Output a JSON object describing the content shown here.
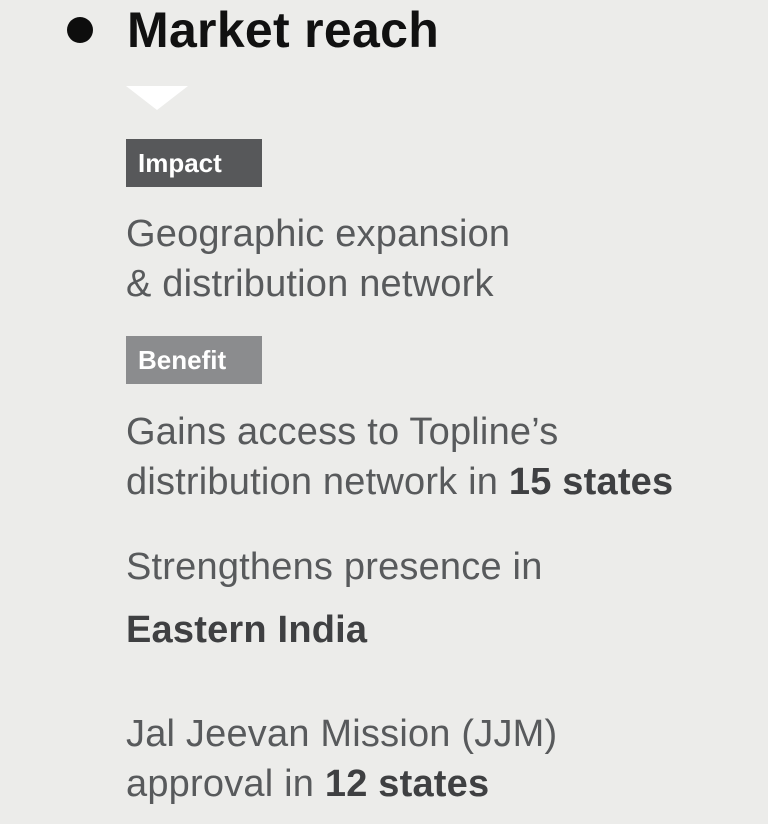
{
  "section": {
    "title": "Market reach"
  },
  "impact": {
    "tag": "Impact",
    "line1": "Geographic expansion",
    "line2": "& distribution network"
  },
  "benefit": {
    "tag": "Benefit",
    "item1": {
      "line1": "Gains access to Topline’s",
      "line2_prefix": "distribution network in ",
      "line2_bold": "15 states"
    },
    "item2": {
      "line1": "Strengthens presence in",
      "line2_bold": "Eastern India"
    },
    "item3": {
      "line1": "Jal Jeevan Mission (JJM)",
      "line2_prefix": "approval in ",
      "line2_bold": "12 states"
    }
  },
  "colors": {
    "background": "#ececea",
    "heading": "#111111",
    "impact_tag": "#57585a",
    "benefit_tag": "#8b8c8e",
    "body_text": "#585a5c",
    "bold_text": "#3f4042"
  },
  "icons": {
    "bullet": "bullet-dot-icon",
    "pointer": "down-triangle-icon"
  }
}
